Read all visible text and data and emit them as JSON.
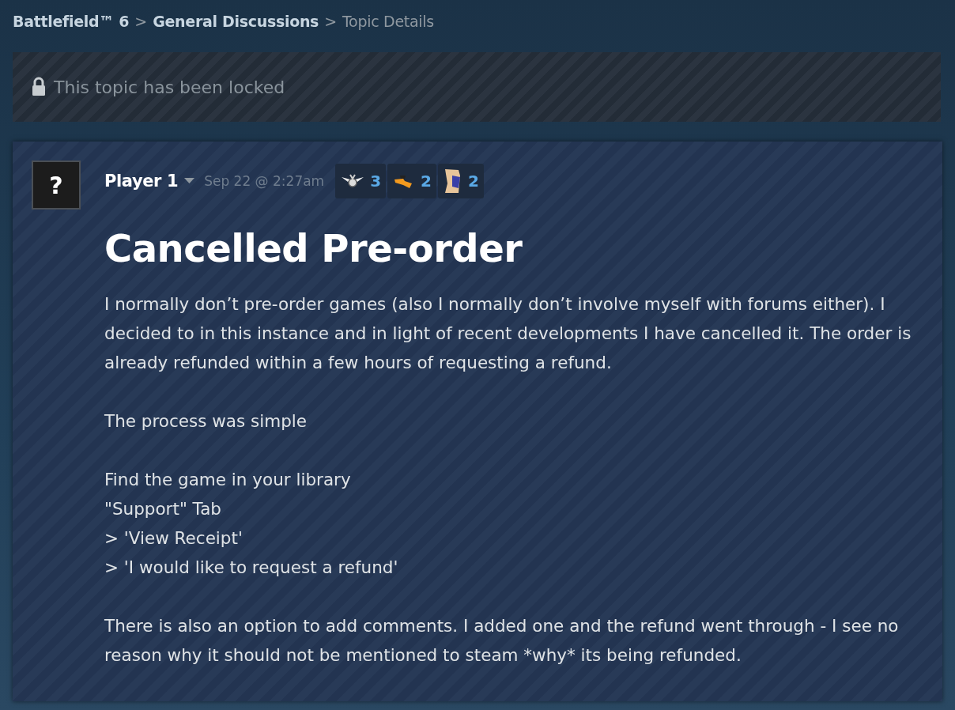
{
  "breadcrumb": [
    {
      "label": "Battlefield™ 6",
      "link": true
    },
    {
      "label": "General Discussions",
      "link": true
    },
    {
      "label": "Topic Details",
      "link": false
    }
  ],
  "separator": ">",
  "lock_notice": "This topic has been locked",
  "post": {
    "author": "Player 1",
    "avatar": "?",
    "date": "Sep 22 @ 2:27am",
    "awards": [
      {
        "kind": "medal",
        "count": "3"
      },
      {
        "kind": "boot",
        "count": "2"
      },
      {
        "kind": "figure",
        "count": "2"
      }
    ],
    "title": "Cancelled Pre-order",
    "body": [
      [
        "I normally don’t pre-order games (also I normally don’t involve myself with forums either). I decided to in this instance and in light of recent developments I have cancelled it. The order is already refunded within a few hours of requesting a refund."
      ],
      [
        "The process was simple"
      ],
      [
        "Find the game in your library",
        "\"Support\" Tab",
        "> 'View Receipt'",
        "> 'I would like to request a refund'"
      ],
      [
        "There is also an option to add comments. I added one and the refund went through - I see no reason why it should not be mentioned to steam *why* its being refunded."
      ]
    ]
  }
}
